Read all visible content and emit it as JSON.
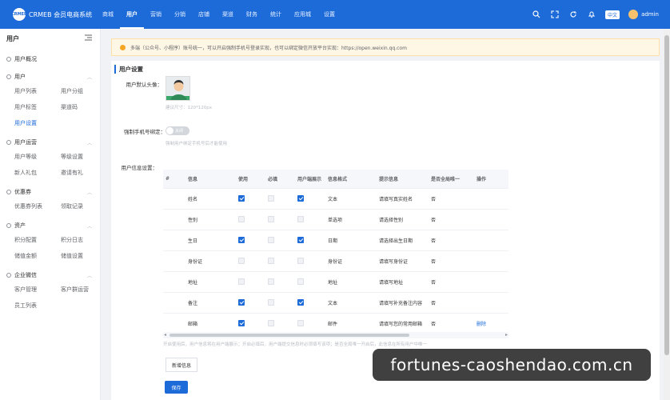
{
  "header": {
    "logo_mark": "CRMEB",
    "logo_text": "CRMEB 会员电商系统",
    "nav": [
      "商城",
      "用户",
      "营销",
      "分销",
      "店铺",
      "渠道",
      "财务",
      "统计",
      "应用城",
      "设置"
    ],
    "active_nav_index": 1,
    "lang_badge": "中文",
    "user_name": "admin"
  },
  "sidebar": {
    "title": "用户",
    "groups": [
      {
        "title": "用户概况",
        "items": []
      },
      {
        "title": "用户",
        "items": [
          "用户列表",
          "用户分组",
          "用户标签",
          "渠道码",
          "用户设置"
        ]
      },
      {
        "title": "用户运营",
        "items": [
          "用户等级",
          "等级设置",
          "新人礼包",
          "邀请有礼"
        ]
      },
      {
        "title": "优惠券",
        "items": [
          "优惠券列表",
          "领取记录"
        ]
      },
      {
        "title": "资产",
        "items": [
          "积分配置",
          "积分日志",
          "储值金额",
          "储值设置"
        ]
      },
      {
        "title": "企业微信",
        "items": [
          "客户管理",
          "客户群运营",
          "员工列表"
        ]
      }
    ],
    "active_item": "用户设置"
  },
  "notice": {
    "text": "多端（公众号、小程序）账号统一，可以开启强制手机号登录实现，也可以绑定微信开放平台实现：https://open.weixin.qq.com"
  },
  "form": {
    "section_title": "用户设置",
    "avatar_label": "用户默认头像：",
    "avatar_hint": "建议尺寸：120*120px",
    "force_phone_label": "强制手机号绑定：",
    "switch_text": "关闭",
    "switch_hint": "强制用户绑定手机号后才能使用",
    "user_info_label": "用户信息设置：",
    "table": {
      "columns": [
        "#",
        "信息",
        "使用",
        "必填",
        "用户端展示",
        "信息格式",
        "提示信息",
        "是否全局唯一",
        "操作"
      ],
      "rows": [
        {
          "name": "姓名",
          "use": true,
          "required": false,
          "show": true,
          "format": "文本",
          "tip": "请填写真实姓名",
          "unique": "否",
          "action": ""
        },
        {
          "name": "性别",
          "use": false,
          "required": false,
          "show": false,
          "format": "单选项",
          "tip": "请选择性别",
          "unique": "否",
          "action": ""
        },
        {
          "name": "生日",
          "use": true,
          "required": false,
          "show": true,
          "format": "日期",
          "tip": "请选择出生日期",
          "unique": "否",
          "action": ""
        },
        {
          "name": "身份证",
          "use": false,
          "required": false,
          "show": false,
          "format": "身份证",
          "tip": "请填写身份证",
          "unique": "否",
          "action": ""
        },
        {
          "name": "地址",
          "use": false,
          "required": false,
          "show": false,
          "format": "地址",
          "tip": "请填写地址",
          "unique": "否",
          "action": ""
        },
        {
          "name": "备注",
          "use": true,
          "required": false,
          "show": true,
          "format": "文本",
          "tip": "请填写补充备注内容",
          "unique": "否",
          "action": ""
        },
        {
          "name": "邮箱",
          "use": true,
          "required": false,
          "show": false,
          "format": "邮件",
          "tip": "请填写您的常用邮箱",
          "unique": "否",
          "action": "删除"
        }
      ]
    },
    "table_hint": "开启使用后，用户信息将在用户端展示；开启必填后，用户端提交信息时必须填写该项；是否全局唯一开启后，此信息在所有用户中唯一",
    "add_button": "新增信息",
    "save_button": "保存"
  },
  "watermark": "fortunes-caoshendao.com.cn",
  "colors": {
    "primary": "#1c6bd9",
    "notice_bg": "#fff7e6",
    "warn": "#f5a623"
  }
}
